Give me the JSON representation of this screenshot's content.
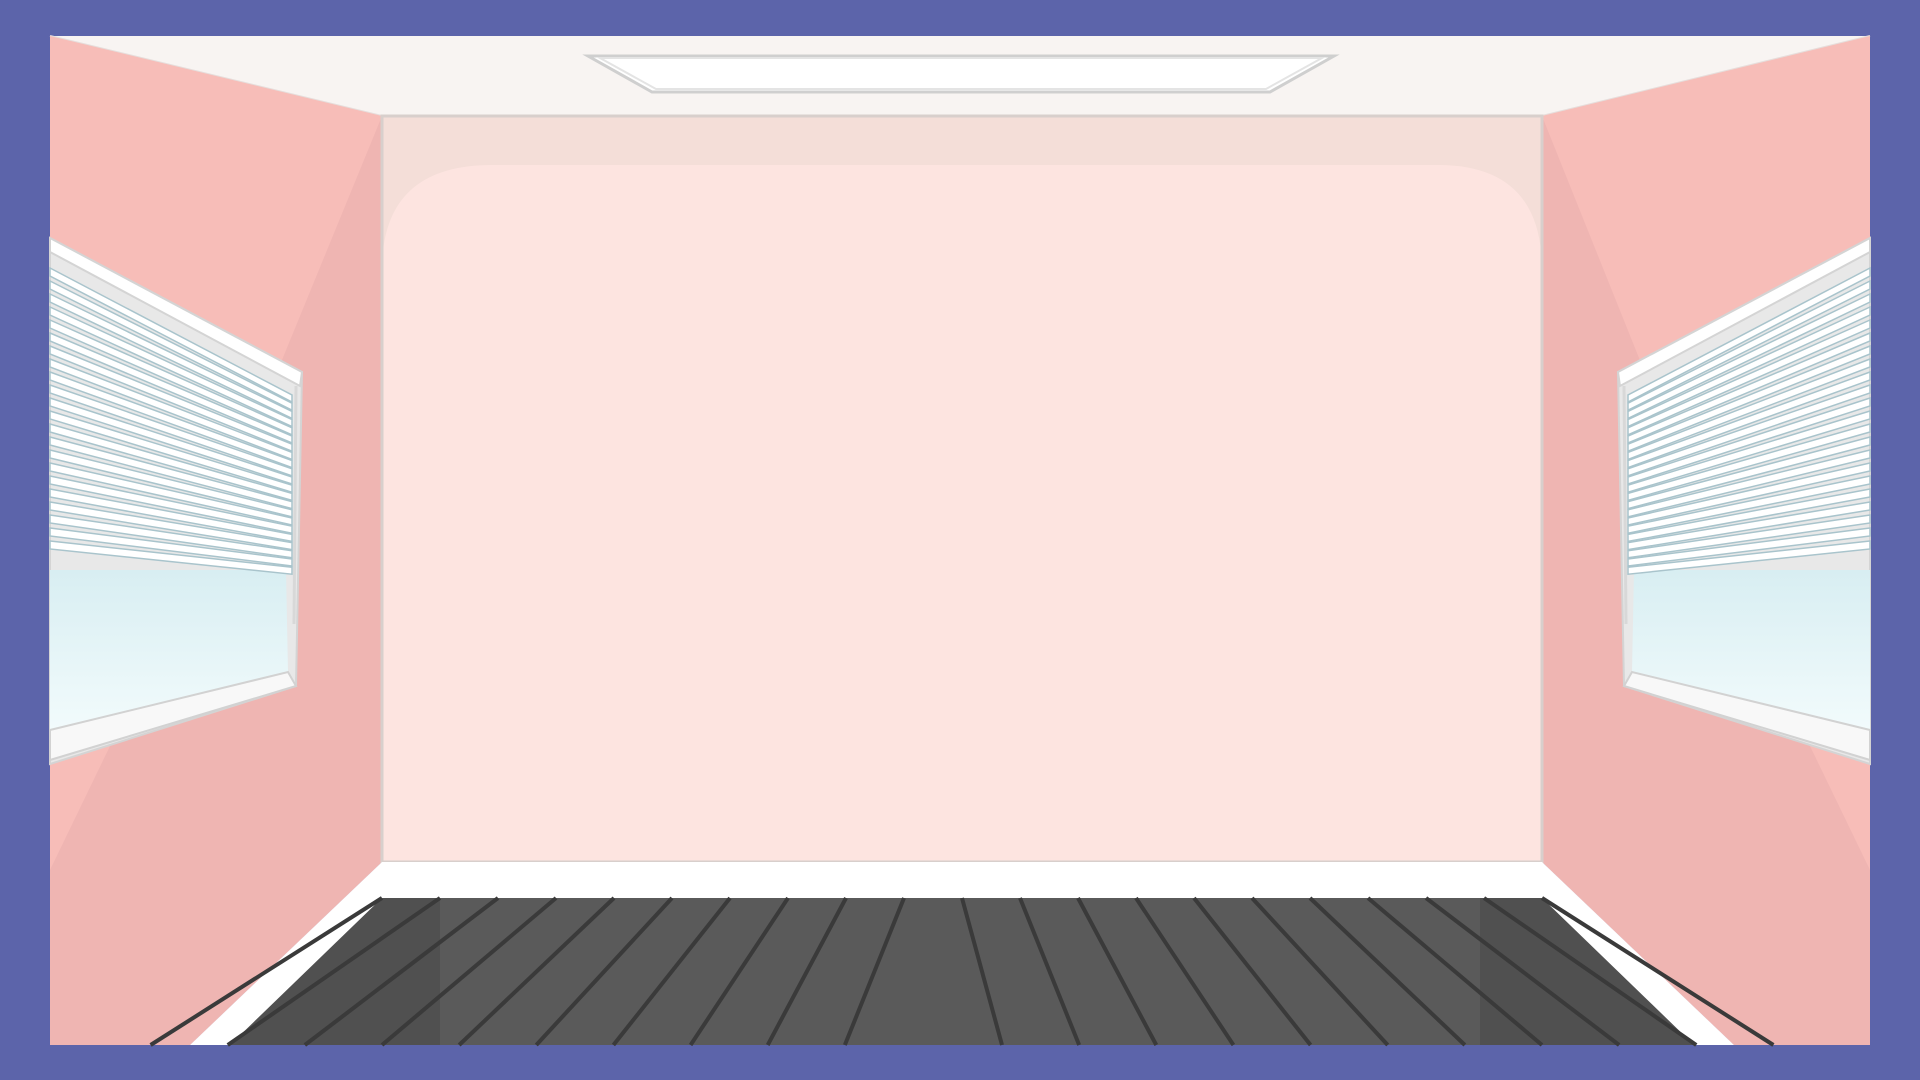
{
  "scene": {
    "subject": "empty-room",
    "colors": {
      "frame": "#5c64aa",
      "ceiling": "#f8f4f2",
      "back_wall": "#f4ded8",
      "back_wall_panel": "#fde4e0",
      "side_wall": "#f7bdb8",
      "side_wall_shadow": "#efb5b2",
      "baseboard": "#ffffff",
      "floor": "#5a5a5a",
      "floor_dark": "#484848",
      "floor_plank_line": "#3a3a3a",
      "ceiling_light": "#ffffff",
      "blind_slat": "#ffffff",
      "blind_shadow": "#a9c4cc",
      "window_glass": "#e6f5f7"
    },
    "elements": {
      "ceiling_light_icon": "rectangular-ceiling-light",
      "left_window_icon": "window-with-blinds",
      "right_window_icon": "window-with-blinds",
      "floor_icon": "wooden-plank-floor"
    }
  }
}
